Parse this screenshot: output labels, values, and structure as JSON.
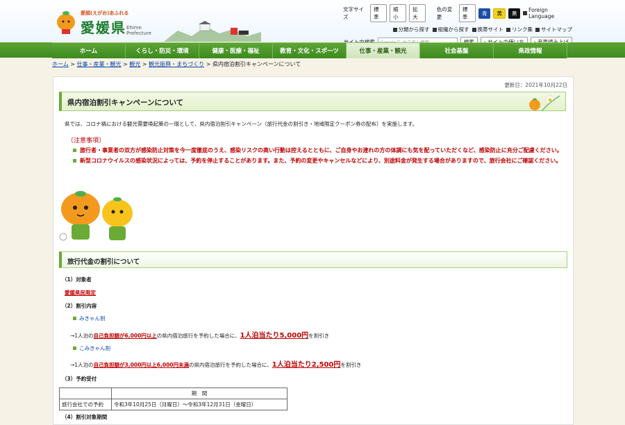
{
  "header": {
    "logo_tag": "愛顔(えがお)あふれる",
    "logo_title": "愛媛県",
    "logo_sub": "Ehime Prefecture",
    "font_size_label": "文字サイズ",
    "font_sizes": [
      "標準",
      "縮小",
      "拡大"
    ],
    "color_label": "色の変更",
    "colors": [
      "標準",
      "青",
      "黄",
      "黒"
    ],
    "foreign_language": "Foreign Language",
    "links": [
      "分類から探す",
      "組織から探す",
      "携帯サイト",
      "リンク集",
      "サイトマップ"
    ],
    "search_label": "サイト内検索",
    "search_placeholder": "Google™ カスタム検索",
    "search_button": "検索",
    "usage_button": "サイトの使い方",
    "read_aloud_button": "音声読み上げ"
  },
  "nav": {
    "items": [
      "ホーム",
      "くらし・防災・環境",
      "健康・医療・福祉",
      "教育・文化・スポーツ",
      "仕事・産業・観光",
      "社会基盤",
      "県政情報"
    ],
    "active_index": 4
  },
  "breadcrumb": {
    "items": [
      "ホーム",
      "仕事・産業・観光",
      "観光",
      "観光振興・まちづくり"
    ],
    "current": "県内宿泊割引キャンペーンについて"
  },
  "main": {
    "updated": "更新日：2021年10月22日",
    "title": "県内宿泊割引キャンペーンについて",
    "intro": "県では、コロナ禍における観光需要喚起策の一環として、県内宿泊割引キャンペーン（旅行代金の割引き・地域限定クーポン券の配布）を実施します。",
    "notice_heading": "〔注意事項〕",
    "notices": [
      "旅行者・事業者の双方が感染防止対策を今一度徹底のうえ、感染リスクの高い行動は控えるとともに、ご自身やお連れの方の体調にも気を配っていただくなど、感染防止に充分ご配慮ください。",
      "新型コロナウイルスの感染状況によっては、予約を停止することがあります。また、予約の変更やキャンセルなどにより、別途料金が発生する場合がありますので、旅行会社にご確認ください。"
    ],
    "section_title": "旅行代金の割引について",
    "target_heading": "（1）対象者",
    "target_value": "愛媛県民限定",
    "discount_heading": "（2）割引内容",
    "mikyan_label": "みきゃん割",
    "mikyan_line": {
      "prefix": "→1人泊の",
      "cond": "自己負担額が6,000円以上",
      "mid": "の県内宿泊旅行を予約した場合に、",
      "amount": "1人泊当たり5,000円",
      "suffix": "を割引き"
    },
    "komikyan_label": "こみきゃん割",
    "komikyan_line": {
      "prefix": "→1人泊の",
      "cond": "自己負担額が3,000円以上6,000円未満",
      "mid": "の県内宿泊旅行を予約した場合に、",
      "amount": "1人泊当たり2,500円",
      "suffix": "を割引き"
    },
    "reservation_heading": "（3）予約受付",
    "table_header": "期　間",
    "table_row_label": "旅行会社での予約",
    "table_row_value": "令和3年10月25日（月曜日）～令和3年12月31日（金曜日）",
    "next_heading": "（4）割引対象期間"
  }
}
